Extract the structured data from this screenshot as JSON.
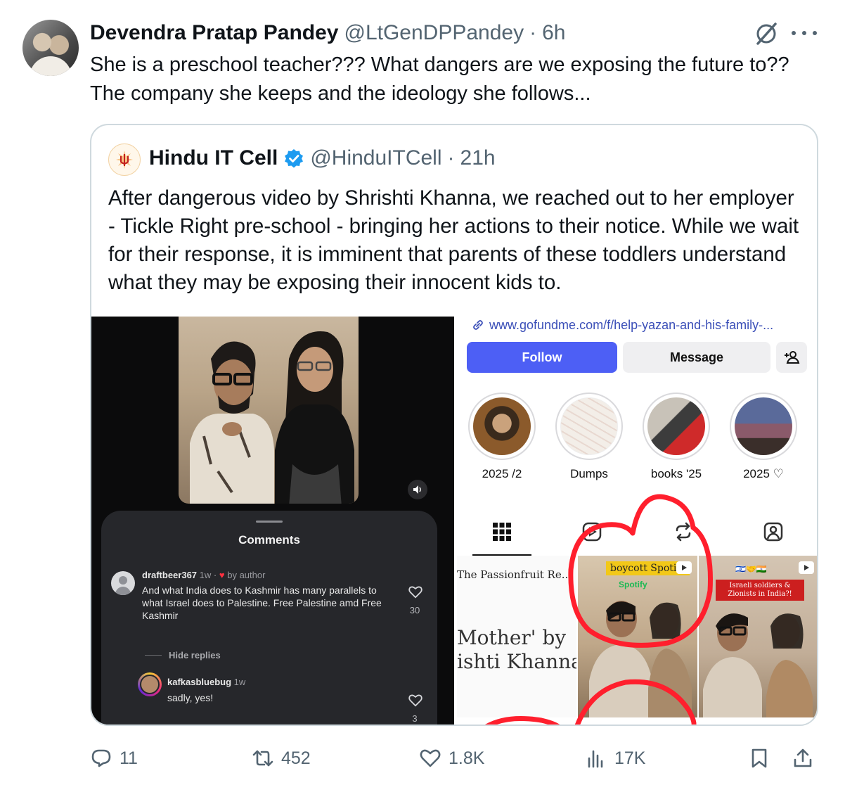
{
  "author": {
    "name": "Devendra Pratap Pandey",
    "handle": "@LtGenDPPandey",
    "separator": "·",
    "time": "6h"
  },
  "tweet_text": "She is a preschool teacher??? What dangers are we exposing the future to?? The company she keeps and the ideology she follows...",
  "quoted": {
    "name": "Hindu IT Cell",
    "handle": "@HinduITCell",
    "separator": "·",
    "time": "21h",
    "text": "After dangerous video by Shrishti Khanna, we reached out to her employer - Tickle Right pre-school - bringing her actions to their notice. While we wait for their response, it is imminent that parents of these toddlers understand what they may be exposing their innocent kids to."
  },
  "comments_panel": {
    "title": "Comments",
    "comment1": {
      "user": "draftbeer367",
      "age": "1w",
      "separator": "·",
      "by_author": "by author",
      "text": "And what India does to Kashmir has many parallels to what Israel does to Palestine. Free Palestine amd Free Kashmir",
      "likes": "30"
    },
    "hide_replies": "Hide replies",
    "comment2": {
      "user": "kafkasbluebug",
      "age": "1w",
      "text": "sadly, yes!",
      "likes": "3"
    }
  },
  "profile": {
    "link": "www.gofundme.com/f/help-yazan-and-his-family-...",
    "follow_label": "Follow",
    "message_label": "Message",
    "highlights": [
      {
        "label": "2025 /2"
      },
      {
        "label": "Dumps"
      },
      {
        "label": "books '25"
      },
      {
        "label": "2025 ♡"
      }
    ],
    "thumbs": {
      "t1_title": "The Passionfruit Re...",
      "t1_big_line1": "Mother' by",
      "t1_big_line2": "ishti Khanna",
      "t2_tag": "boycott Spotify",
      "t2_spotify": "Spotify",
      "t3_tag": "Israeli soldiers & Zionists in India?!"
    }
  },
  "actions": {
    "replies": "11",
    "reposts": "452",
    "likes": "1.8K",
    "views": "17K"
  },
  "colors": {
    "text": "#0f1419",
    "muted": "#536471",
    "border": "#cfd9de",
    "verified": "#1d9bf0",
    "follow": "#4d5ff5",
    "annotation": "#ff1f2d"
  }
}
